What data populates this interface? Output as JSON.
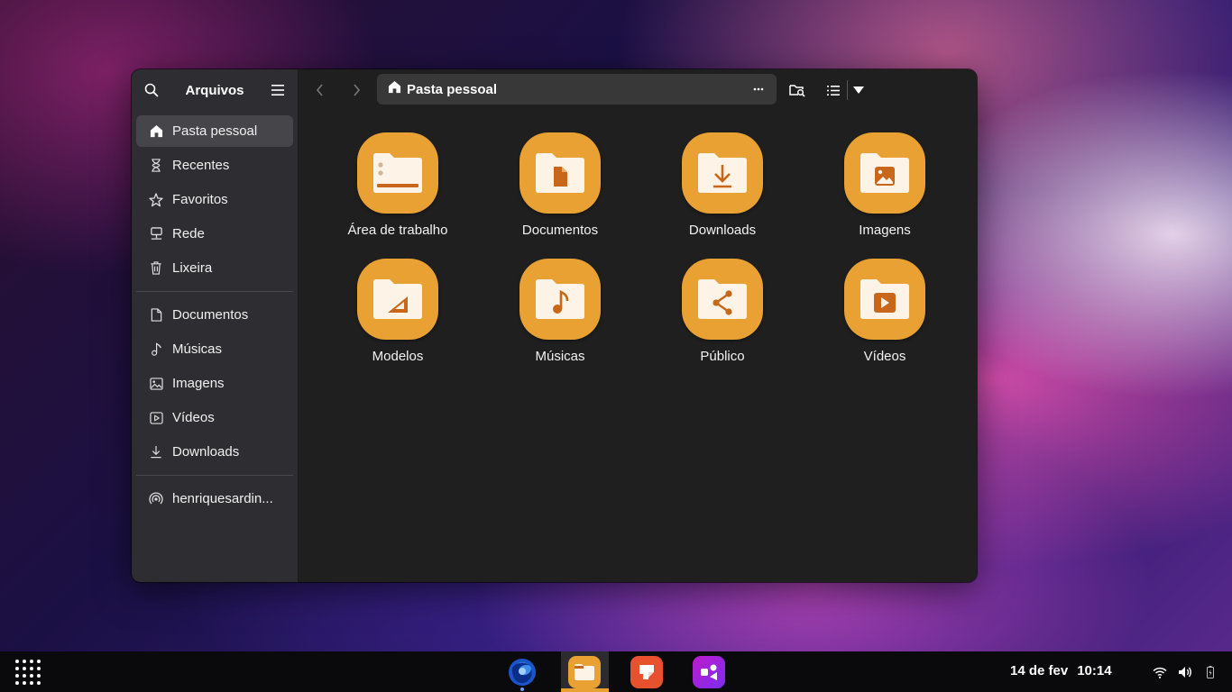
{
  "window": {
    "app_title": "Arquivos",
    "path_label": "Pasta pessoal"
  },
  "sidebar": {
    "places": [
      {
        "label": "Pasta pessoal",
        "icon": "home-icon",
        "active": true
      },
      {
        "label": "Recentes",
        "icon": "hourglass-icon"
      },
      {
        "label": "Favoritos",
        "icon": "star-icon"
      },
      {
        "label": "Rede",
        "icon": "network-icon"
      },
      {
        "label": "Lixeira",
        "icon": "trash-icon"
      }
    ],
    "bookmarks": [
      {
        "label": "Documentos",
        "icon": "document-icon"
      },
      {
        "label": "Músicas",
        "icon": "music-icon"
      },
      {
        "label": "Imagens",
        "icon": "image-icon"
      },
      {
        "label": "Vídeos",
        "icon": "video-icon"
      },
      {
        "label": "Downloads",
        "icon": "download-icon"
      }
    ],
    "devices": [
      {
        "label": "henriquesardin...",
        "icon": "remote-share-icon"
      }
    ]
  },
  "files": [
    {
      "label": "Área de trabalho",
      "icon": "desktop-folder-icon"
    },
    {
      "label": "Documentos",
      "icon": "documents-folder-icon"
    },
    {
      "label": "Downloads",
      "icon": "downloads-folder-icon"
    },
    {
      "label": "Imagens",
      "icon": "pictures-folder-icon"
    },
    {
      "label": "Modelos",
      "icon": "templates-folder-icon"
    },
    {
      "label": "Músicas",
      "icon": "music-folder-icon"
    },
    {
      "label": "Público",
      "icon": "public-folder-icon"
    },
    {
      "label": "Vídeos",
      "icon": "videos-folder-icon"
    }
  ],
  "taskbar": {
    "date": "14 de fev",
    "time": "10:14",
    "apps": [
      "firefox-icon",
      "files-icon",
      "software-icon",
      "flathub-icon"
    ]
  },
  "colors": {
    "folder": "#e8a132",
    "folder_glyph": "#c8661a",
    "window_bg": "#1f1f1f",
    "sidebar_bg": "#2e2e32"
  }
}
